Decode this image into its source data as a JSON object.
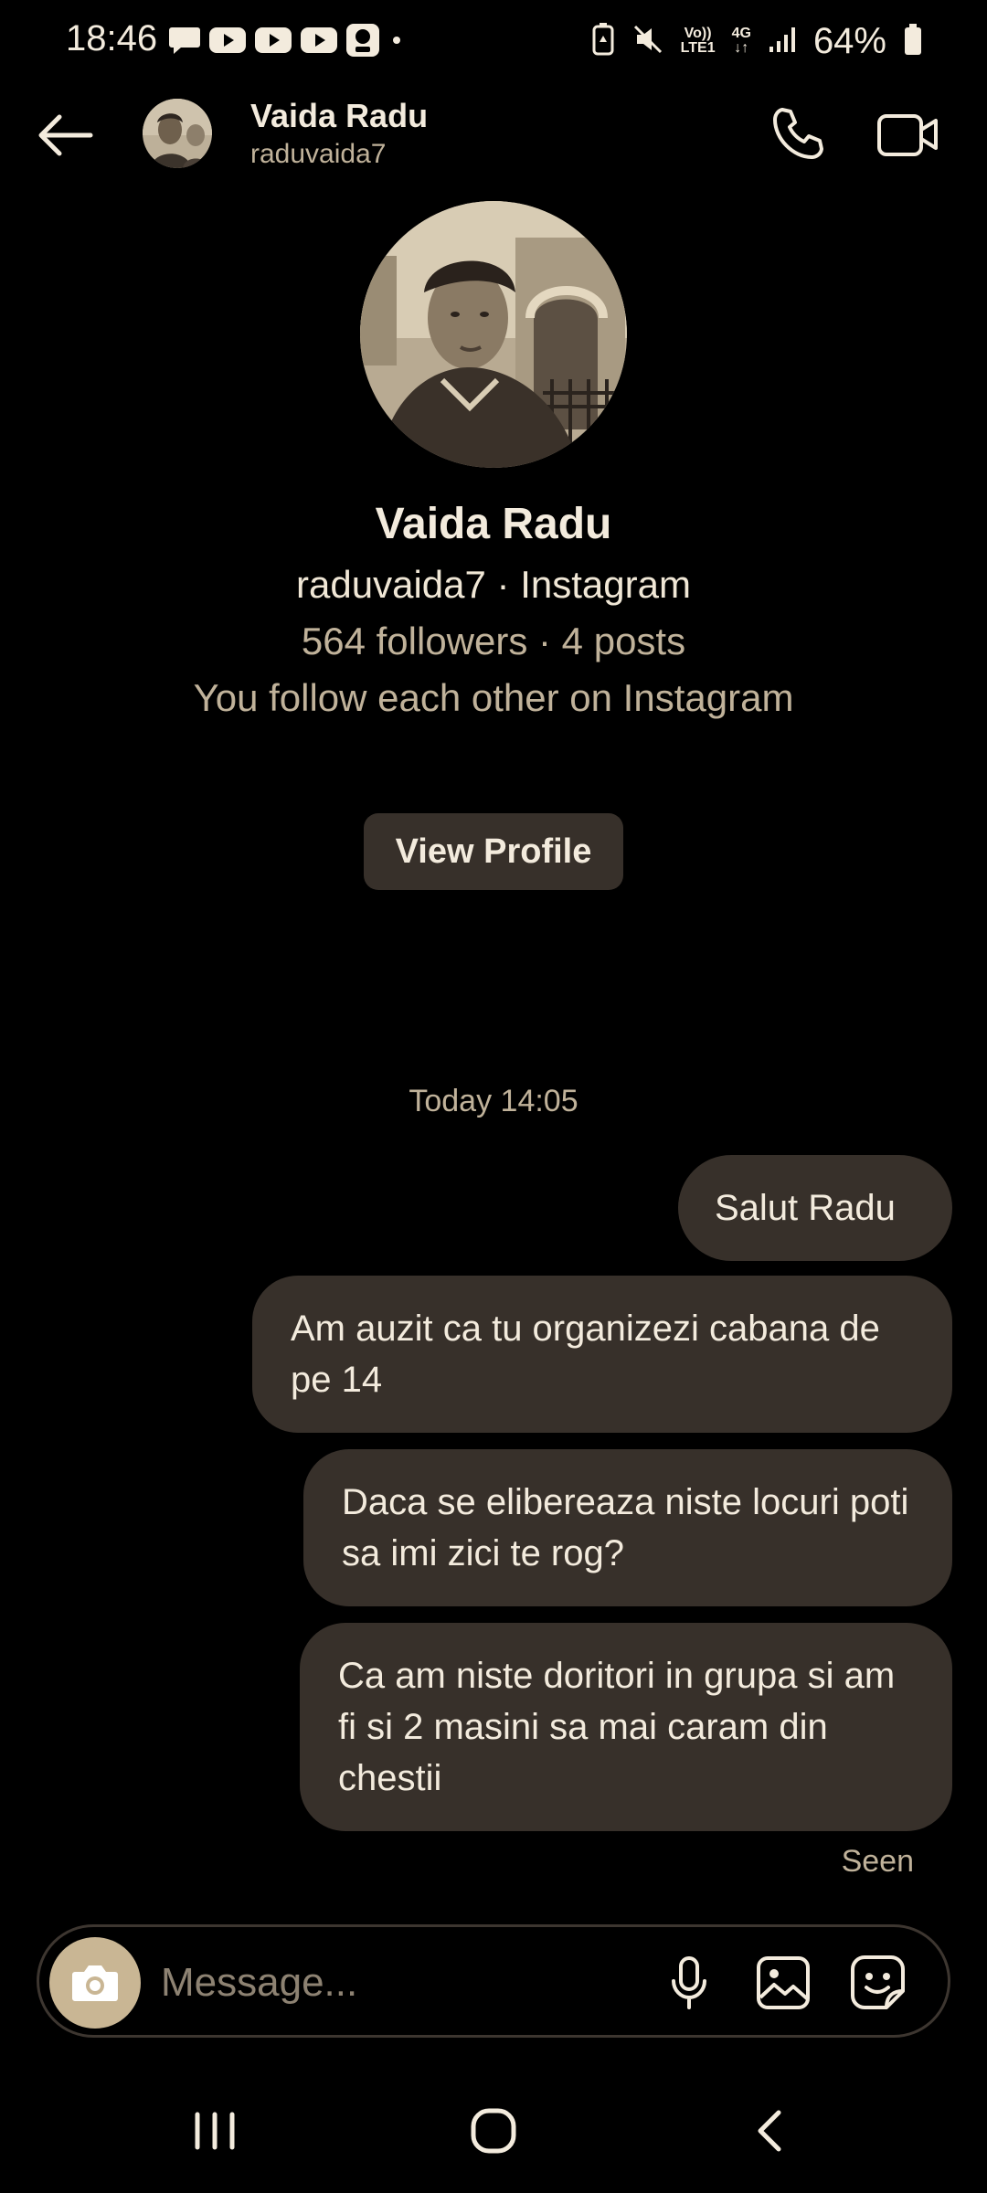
{
  "status_bar": {
    "time": "18:46",
    "lte_top": "Vo))",
    "lte_bottom": "LTE1",
    "network_top": "4G",
    "network_bottom": "↓↑",
    "battery_percent": "64%",
    "icons": [
      "message-icon",
      "youtube-icon",
      "youtube-icon",
      "youtube-icon",
      "lidl-plus-icon",
      "dot-icon",
      "battery-saver-icon",
      "mute-icon",
      "volte-icon",
      "4g-icon",
      "signal-icon",
      "battery-icon"
    ]
  },
  "header": {
    "name": "Vaida Radu",
    "username": "raduvaida7",
    "icons": [
      "back-arrow-icon",
      "phone-icon",
      "video-camera-icon"
    ]
  },
  "profile": {
    "name": "Vaida Radu",
    "line1": "raduvaida7 · Instagram",
    "line2": "564 followers · 4 posts",
    "line3": "You follow each other on Instagram",
    "view_profile_label": "View Profile"
  },
  "conversation": {
    "timestamp": "Today 14:05",
    "messages": [
      {
        "text": "Salut Radu"
      },
      {
        "text": "Am auzit ca tu organizezi cabana de pe 14"
      },
      {
        "text": "Daca se elibereaza niste locuri poti sa imi zici te rog?"
      },
      {
        "text": "Ca am niste doritori in grupa si am fi si 2 masini sa mai caram din chestii"
      }
    ],
    "seen_label": "Seen"
  },
  "composer": {
    "placeholder": "Message...",
    "icons": [
      "camera-icon",
      "microphone-icon",
      "gallery-icon",
      "sticker-icon"
    ]
  },
  "navigation": {
    "icons": [
      "recent-apps-icon",
      "home-icon",
      "back-icon"
    ]
  },
  "colors": {
    "background": "#000000",
    "bubble": "#37302a",
    "text": "#f3ebdd",
    "muted_text": "#c0b29a",
    "camera_button": "#c9b694"
  }
}
